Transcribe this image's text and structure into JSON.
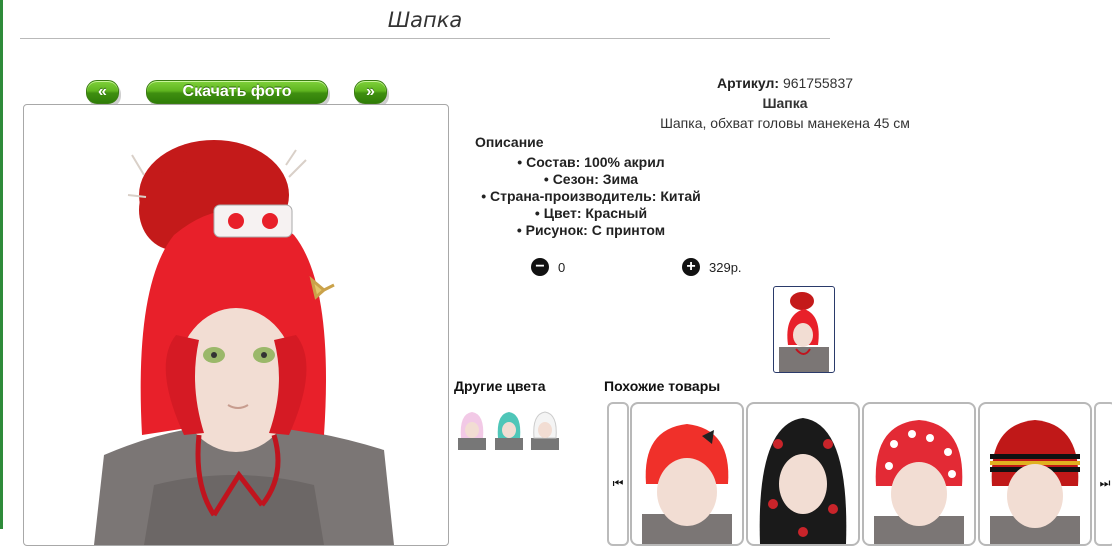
{
  "page": {
    "title": "Шапка"
  },
  "gallery": {
    "prev_label": "«",
    "download_label": "Скачать фото",
    "next_label": "»"
  },
  "product": {
    "article_label": "Артикул:",
    "article_value": "961755837",
    "name": "Шапка",
    "short_description": "Шапка, обхват головы манекена 45 см",
    "description_title": "Описание",
    "specs": [
      "Состав: 100% акрил",
      "Сезон: Зима",
      "Страна-производитель: Китай",
      "Цвет: Красный",
      "Рисунок: С принтом"
    ],
    "quantity": "0",
    "price": "329р.",
    "color": "#e8202a"
  },
  "other_colors": {
    "title": "Другие цвета",
    "items": [
      {
        "color": "#f2c9e6",
        "icon": "hat-pink"
      },
      {
        "color": "#4fc6b8",
        "icon": "hat-turquoise"
      },
      {
        "color": "#f4f4f4",
        "icon": "hat-white"
      }
    ]
  },
  "similar": {
    "title": "Похожие товары",
    "prev_icon": "arrow-left-icon",
    "next_icon": "arrow-right-icon",
    "prev_glyph": "⏮",
    "next_glyph": "⏭",
    "items": [
      {
        "icon": "hat-red-bow",
        "color": "#f0302a"
      },
      {
        "icon": "balaclava-black-mickey",
        "color": "#1a1a1a"
      },
      {
        "icon": "hat-red-polka",
        "color": "#e32a35"
      },
      {
        "icon": "hat-striped",
        "color": "#c01818"
      }
    ]
  }
}
